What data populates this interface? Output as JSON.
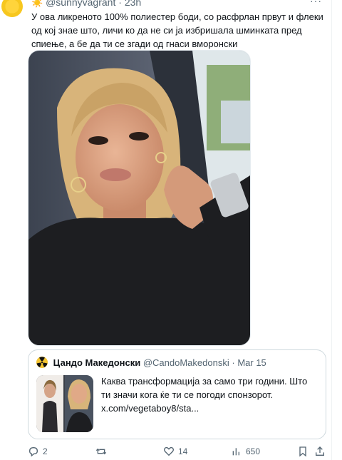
{
  "tweet": {
    "author_emoji": "☀️",
    "handle": "@sunnyvagrant",
    "separator": "·",
    "time": "23h",
    "more_label": "···",
    "text": "У ова ликреното 100% полиестер боди, со расфрлан првут и флеки од кој знае што, личи ко да не си ја избришала шминката пред спиење, а бе да ти се згади од гнаси вморонски"
  },
  "quote": {
    "name": "Цандо Македонски",
    "handle": "@CandoMakedonski",
    "separator": "·",
    "date": "Mar 15",
    "text": "Каква трансформација за само три години. Што ти значи кога ќе ти се погоди спонзорот.",
    "link": "x.com/vegetaboy8/sta..."
  },
  "actions": {
    "replies": "2",
    "reposts": "",
    "likes": "14",
    "views": "650"
  },
  "colors": {
    "text": "#0f1419",
    "muted": "#536471",
    "border": "#cfd9de",
    "avatar": "#ffd43b"
  }
}
